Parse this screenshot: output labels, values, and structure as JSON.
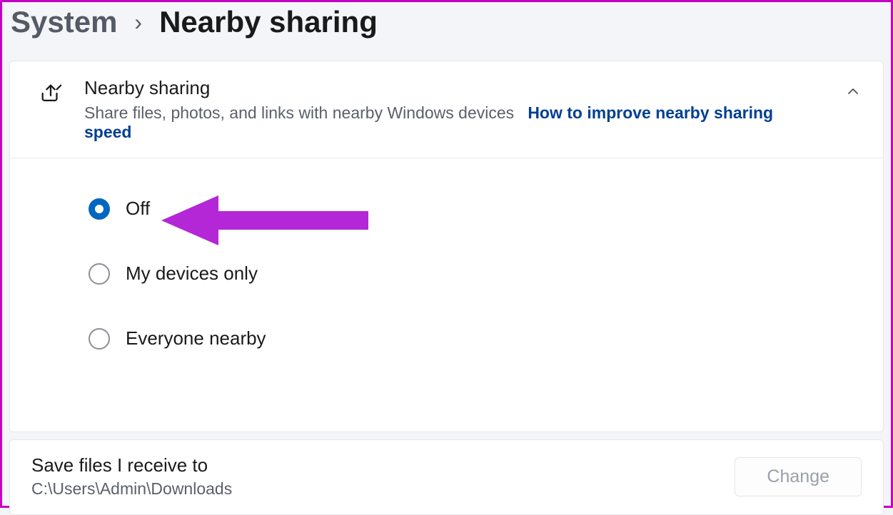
{
  "breadcrumb": {
    "parent": "System",
    "separator": "›",
    "current": "Nearby sharing"
  },
  "expander": {
    "title": "Nearby sharing",
    "subtitle": "Share files, photos, and links with nearby Windows devices",
    "link": "How to improve nearby sharing speed"
  },
  "radios": {
    "selected_index": 0,
    "options": [
      {
        "label": "Off"
      },
      {
        "label": "My devices only"
      },
      {
        "label": "Everyone nearby"
      }
    ]
  },
  "save": {
    "title": "Save files I receive to",
    "path": "C:\\Users\\Admin\\Downloads",
    "button": "Change"
  }
}
